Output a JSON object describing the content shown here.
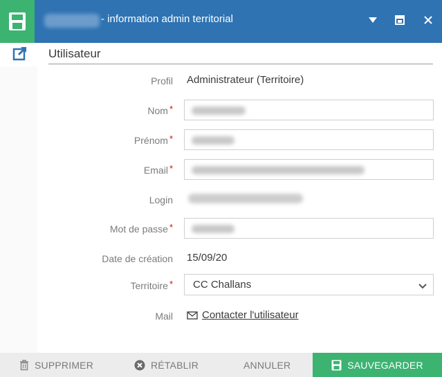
{
  "window": {
    "title": "- information admin territorial"
  },
  "section": {
    "title": "Utilisateur"
  },
  "form": {
    "profil": {
      "label": "Profil",
      "value": "Administrateur (Territoire)"
    },
    "nom": {
      "label": "Nom",
      "required_mark": "*"
    },
    "prenom": {
      "label": "Prénom",
      "required_mark": "*"
    },
    "email": {
      "label": "Email",
      "required_mark": "*"
    },
    "login": {
      "label": "Login"
    },
    "mot_de_passe": {
      "label": "Mot de passe",
      "required_mark": "*"
    },
    "date_creation": {
      "label": "Date de création",
      "value": "15/09/20"
    },
    "territoire": {
      "label": "Territoire",
      "required_mark": "*",
      "selected": "CC Challans"
    },
    "mail": {
      "label": "Mail",
      "link": "Contacter l'utilisateur"
    }
  },
  "footer": {
    "delete_label": "SUPPRIMER",
    "restore_label": "RÉTABLIR",
    "cancel_label": "ANNULER",
    "save_label": "SAUVEGARDER"
  },
  "colors": {
    "titlebar": "#2f73b2",
    "accent_green": "#3cb371",
    "required": "#cc1111"
  },
  "icons": {
    "window": "save-icon",
    "dropdown": "caret-down-icon",
    "restore": "restore-window-icon",
    "close": "close-icon",
    "section": "external-edit-icon",
    "select": "chevron-down-icon",
    "mail": "envelope-icon",
    "delete": "trash-icon",
    "restore_btn": "x-circle-icon",
    "save": "save-icon"
  }
}
